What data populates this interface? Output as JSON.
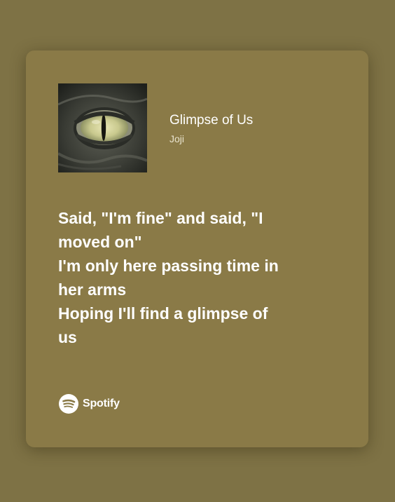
{
  "track": {
    "title": "Glimpse of Us",
    "artist": "Joji",
    "album_art_icon": "crocodile-eye-album-art"
  },
  "lyrics": [
    "Said, \"I'm fine\" and said, \"I",
    "moved on\"",
    "I'm only here passing time in",
    "her arms",
    "Hoping I'll find a glimpse of",
    "us"
  ],
  "brand": {
    "name": "Spotify",
    "icon": "spotify-logo-icon"
  },
  "colors": {
    "background": "#7e7245",
    "card": "#8a7a47",
    "text": "#ffffff"
  }
}
